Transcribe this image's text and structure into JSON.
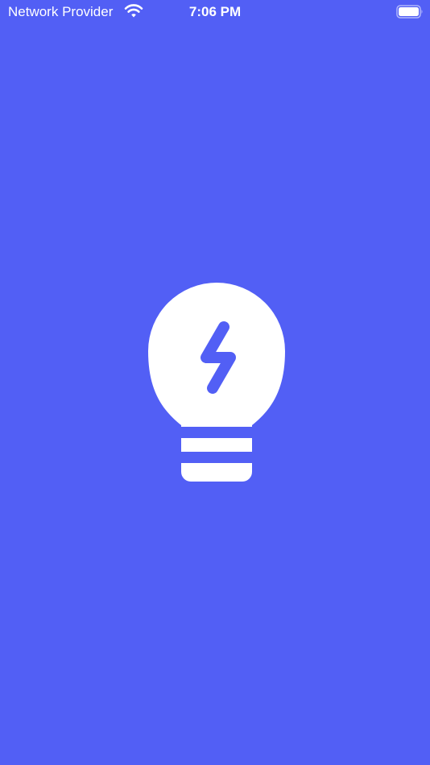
{
  "status_bar": {
    "carrier": "Network Provider",
    "time": "7:06 PM",
    "wifi_icon": "wifi-icon",
    "battery_icon": "battery-icon"
  },
  "splash": {
    "logo_icon": "lightbulb-bolt-icon",
    "background_color": "#525ff5",
    "foreground_color": "#ffffff"
  }
}
